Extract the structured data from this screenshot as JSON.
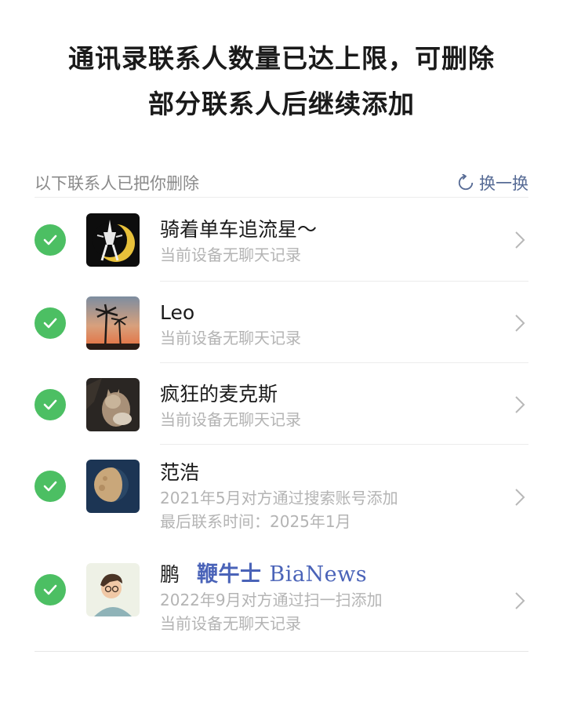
{
  "header": {
    "title_line1": "通讯录联系人数量已达上限，可删除",
    "title_line2": "部分联系人后继续添加"
  },
  "section": {
    "label": "以下联系人已把你删除",
    "refresh_label": "换一换"
  },
  "contacts": [
    {
      "name": "骑着单车追流星～",
      "lines": [
        "当前设备无聊天记录"
      ],
      "checked": true,
      "avatar": "sailor-moon-avatar"
    },
    {
      "name": "Leo",
      "lines": [
        "当前设备无聊天记录"
      ],
      "checked": true,
      "avatar": "palm-sunset-avatar"
    },
    {
      "name": "疯狂的麦克斯",
      "lines": [
        "当前设备无聊天记录"
      ],
      "checked": true,
      "avatar": "cat-avatar"
    },
    {
      "name": "范浩",
      "lines": [
        "2021年5月对方通过搜索账号添加",
        "最后联系时间：2025年1月"
      ],
      "checked": true,
      "avatar": "moon-avatar"
    },
    {
      "name": "鹏",
      "lines": [
        "2022年9月对方通过扫一扫添加",
        "当前设备无聊天记录"
      ],
      "checked": true,
      "avatar": "cartoon-boy-avatar"
    }
  ],
  "watermark": {
    "cn": "鞭牛士",
    "en": "BiaNews"
  },
  "colors": {
    "check": "#4cbf63",
    "link": "#576b95",
    "subtext": "#b4b4b4"
  }
}
